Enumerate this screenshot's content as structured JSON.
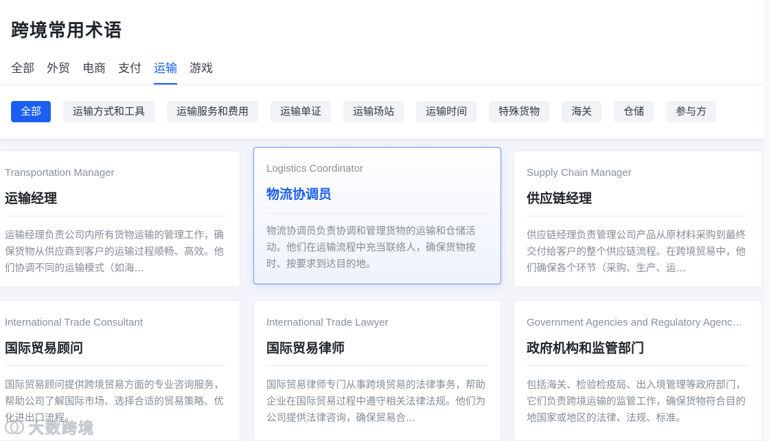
{
  "page": {
    "title": "跨境常用术语"
  },
  "tabs": [
    {
      "label": "全部",
      "active": false
    },
    {
      "label": "外贸",
      "active": false
    },
    {
      "label": "电商",
      "active": false
    },
    {
      "label": "支付",
      "active": false
    },
    {
      "label": "运输",
      "active": true
    },
    {
      "label": "游戏",
      "active": false
    }
  ],
  "chips": [
    {
      "label": "全部",
      "active": true
    },
    {
      "label": "运输方式和工具",
      "active": false
    },
    {
      "label": "运输服务和费用",
      "active": false
    },
    {
      "label": "运输单证",
      "active": false
    },
    {
      "label": "运输场站",
      "active": false
    },
    {
      "label": "运输时间",
      "active": false
    },
    {
      "label": "特殊货物",
      "active": false
    },
    {
      "label": "海关",
      "active": false
    },
    {
      "label": "仓储",
      "active": false
    },
    {
      "label": "参与方",
      "active": false
    }
  ],
  "cards": [
    {
      "en": "Transportation Manager",
      "cn": "运输经理",
      "desc": "运输经理负责公司内所有货物运输的管理工作，确保货物从供应商到客户的运输过程顺畅、高效。他们协调不同的运输模式（如海…"
    },
    {
      "en": "Logistics Coordinator",
      "cn": "物流协调员",
      "desc": "物流协调员负责协调和管理货物的运输和仓储活动。他们在运输流程中充当联络人，确保货物按时、按要求到达目的地。"
    },
    {
      "en": "Supply Chain Manager",
      "cn": "供应链经理",
      "desc": "供应链经理负责管理公司产品从原材料采购到最终交付给客户的整个供应链流程。在跨境贸易中，他们确保各个环节（采购、生产、运…"
    },
    {
      "en": "International Trade Consultant",
      "cn": "国际贸易顾问",
      "desc": "国际贸易顾问提供跨境贸易方面的专业咨询服务，帮助公司了解国际市场、选择合适的贸易策略、优化进出口流程。"
    },
    {
      "en": "International Trade Lawyer",
      "cn": "国际贸易律师",
      "desc": "国际贸易律师专门从事跨境贸易的法律事务，帮助企业在国际贸易过程中遵守相关法律法规。他们为公司提供法律咨询，确保贸易合…"
    },
    {
      "en": "Government Agencies and Regulatory Agenc…",
      "cn": "政府机构和监管部门",
      "desc": "包括海关、检验检疫局、出入境管理等政府部门，它们负责跨境运输的监管工作，确保货物符合目的地国家或地区的法律、法规、标准。"
    }
  ],
  "watermark": {
    "text": "大数跨境"
  }
}
